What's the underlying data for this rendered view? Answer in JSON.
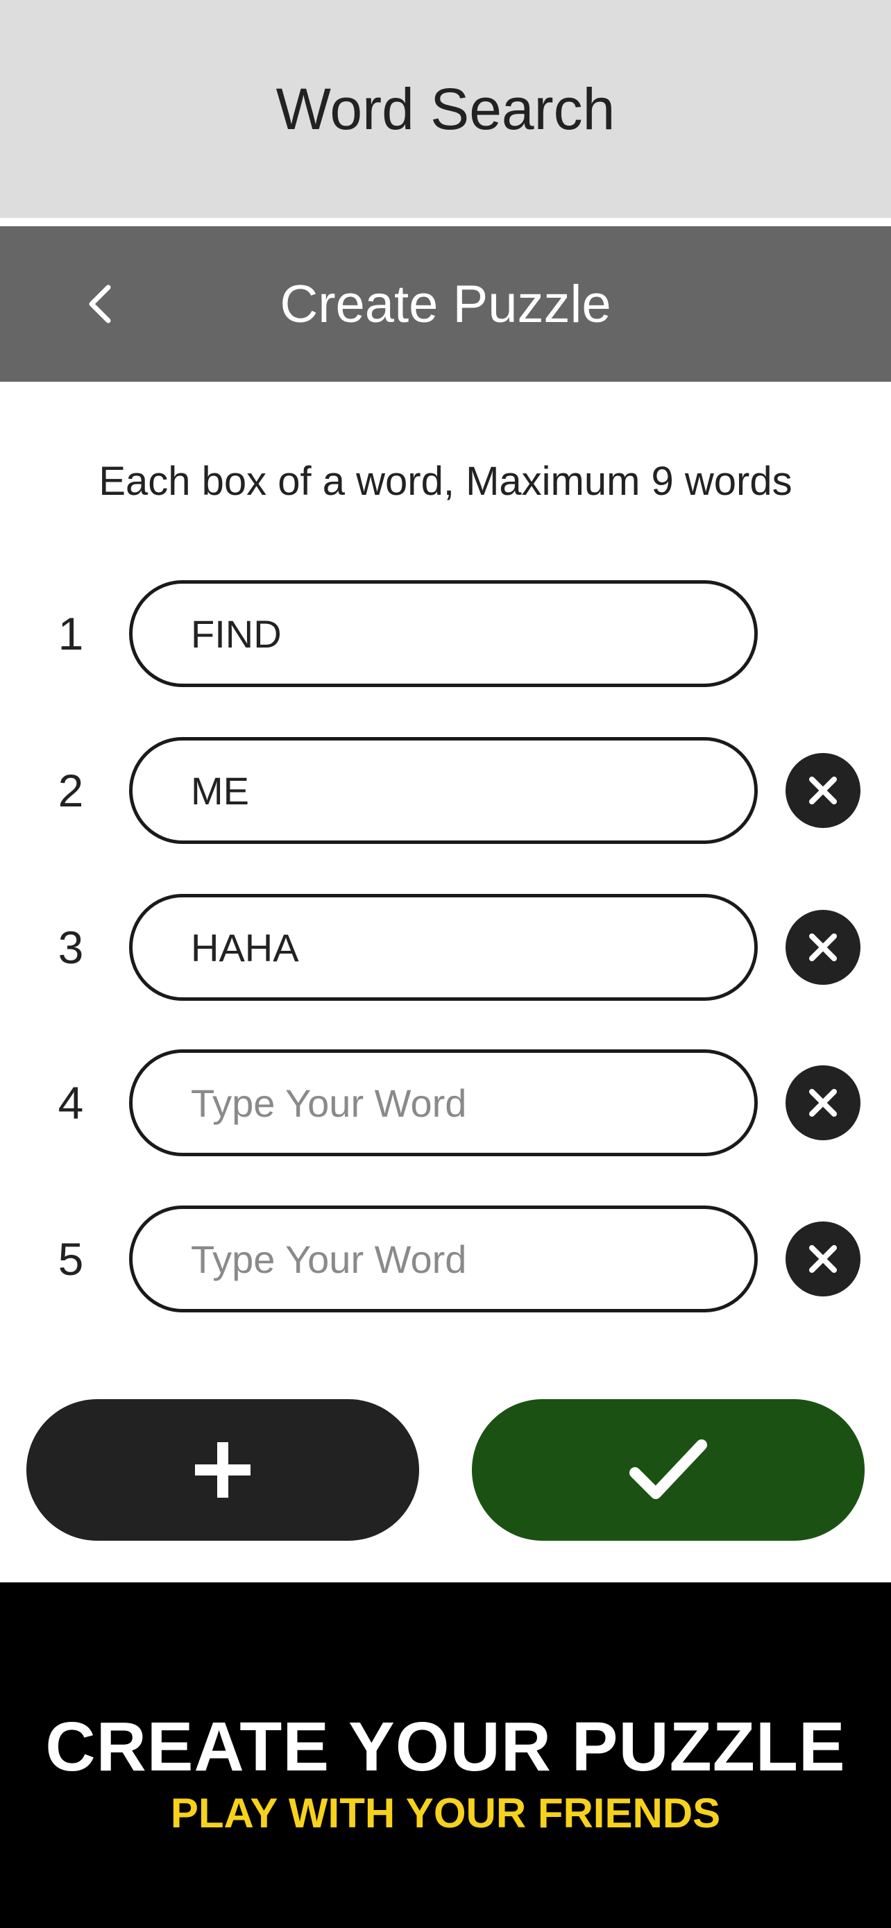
{
  "app": {
    "title": "Word Search"
  },
  "nav": {
    "title": "Create Puzzle",
    "back_icon": "chevron-left-icon"
  },
  "instructions": "Each box of a word, Maximum 9 words",
  "words": [
    {
      "number": "1",
      "value": "FIND",
      "placeholder": "Type Your Word",
      "removable": false
    },
    {
      "number": "2",
      "value": "ME",
      "placeholder": "Type Your Word",
      "removable": true
    },
    {
      "number": "3",
      "value": "HAHA",
      "placeholder": "Type Your Word",
      "removable": true
    },
    {
      "number": "4",
      "value": "",
      "placeholder": "Type Your Word",
      "removable": true
    },
    {
      "number": "5",
      "value": "",
      "placeholder": "Type Your Word",
      "removable": true
    }
  ],
  "actions": {
    "add_icon": "plus-icon",
    "confirm_icon": "checkmark-icon"
  },
  "promo": {
    "headline": "CREATE YOUR PUZZLE",
    "subline": "PLAY WITH YOUR FRIENDS"
  },
  "colors": {
    "header_bg": "#dddddd",
    "nav_bg": "#666666",
    "add_button": "#222222",
    "confirm_button": "#1b5213",
    "promo_bg": "#000000",
    "promo_accent": "#f6d21c"
  }
}
